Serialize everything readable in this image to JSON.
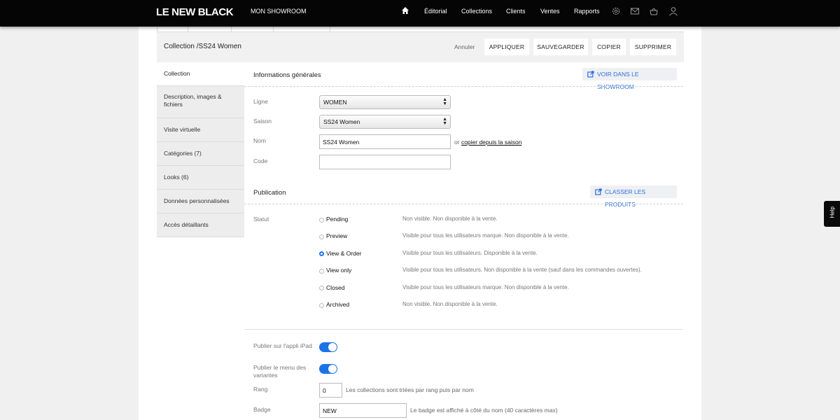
{
  "app": {
    "logo": "LE NEW BLACK",
    "showroom": "MON SHOWROOM"
  },
  "nav": {
    "editorial": "Éditorial",
    "collections": "Collections",
    "clients": "Clients",
    "ventes": "Ventes",
    "rapports": "Rapports"
  },
  "header": {
    "title": "Collection /SS24 Women",
    "cancel": "Annuler",
    "apply": "APPLIQUER",
    "save": "SAUVEGARDER",
    "copy": "COPIER",
    "delete": "SUPPRIMER"
  },
  "sidebar": {
    "items": [
      {
        "label": "Collection"
      },
      {
        "label": "Description, images & fichiers"
      },
      {
        "label": "Visite virtuelle"
      },
      {
        "label": "Catégories (7)"
      },
      {
        "label": "Looks (6)"
      },
      {
        "label": "Données personnalisées"
      },
      {
        "label": "Accès détaillants"
      }
    ]
  },
  "general": {
    "title": "Informations générales",
    "view_showroom": "VOIR DANS LE SHOWROOM",
    "ligne_label": "Ligne",
    "ligne_value": "WOMEN",
    "saison_label": "Saison",
    "saison_value": "SS24 Women",
    "nom_label": "Nom",
    "nom_value": "SS24 Women",
    "nom_or": "or",
    "copy_from_season": "copier depuis la saison",
    "code_label": "Code",
    "code_value": ""
  },
  "publication": {
    "title": "Publication",
    "sort_products": "CLASSER LES PRODUITS",
    "status_label": "Statut",
    "statuses": [
      {
        "label": "Pending",
        "desc": "Non visible. Non disponible à la vente."
      },
      {
        "label": "Preview",
        "desc": "Visible pour tous les utilisateurs marque. Non disponible à la vente."
      },
      {
        "label": "View & Order",
        "desc": "Visible pour tous les utilisateurs. Disponible à la vente."
      },
      {
        "label": "View only",
        "desc": "Visible pour tous les utilisateurs. Non disponible à la vente (sauf dans les commandes ouvertes)."
      },
      {
        "label": "Closed",
        "desc": "Visible pour tous les utilisateurs marque. Non disponible à la vente."
      },
      {
        "label": "Archived",
        "desc": "Non visible. Non disponible à la vente."
      }
    ],
    "selected_status": "View & Order"
  },
  "options": {
    "ipad_label": "Publier sur l'appli iPad",
    "ipad_on": true,
    "variants_label": "Publier le menu des variantes",
    "variants_on": true,
    "rang_label": "Rang",
    "rang_value": "0",
    "rang_hint": "Les collections sont triées par rang puis par nom",
    "badge_label": "Badge",
    "badge_value": "NEW",
    "badge_hint": "Le badge est affiché à côté du nom (40 caractères max)"
  },
  "help": {
    "label": "Help"
  },
  "colors": {
    "accent": "#1a73e8",
    "topbar": "#050505"
  }
}
